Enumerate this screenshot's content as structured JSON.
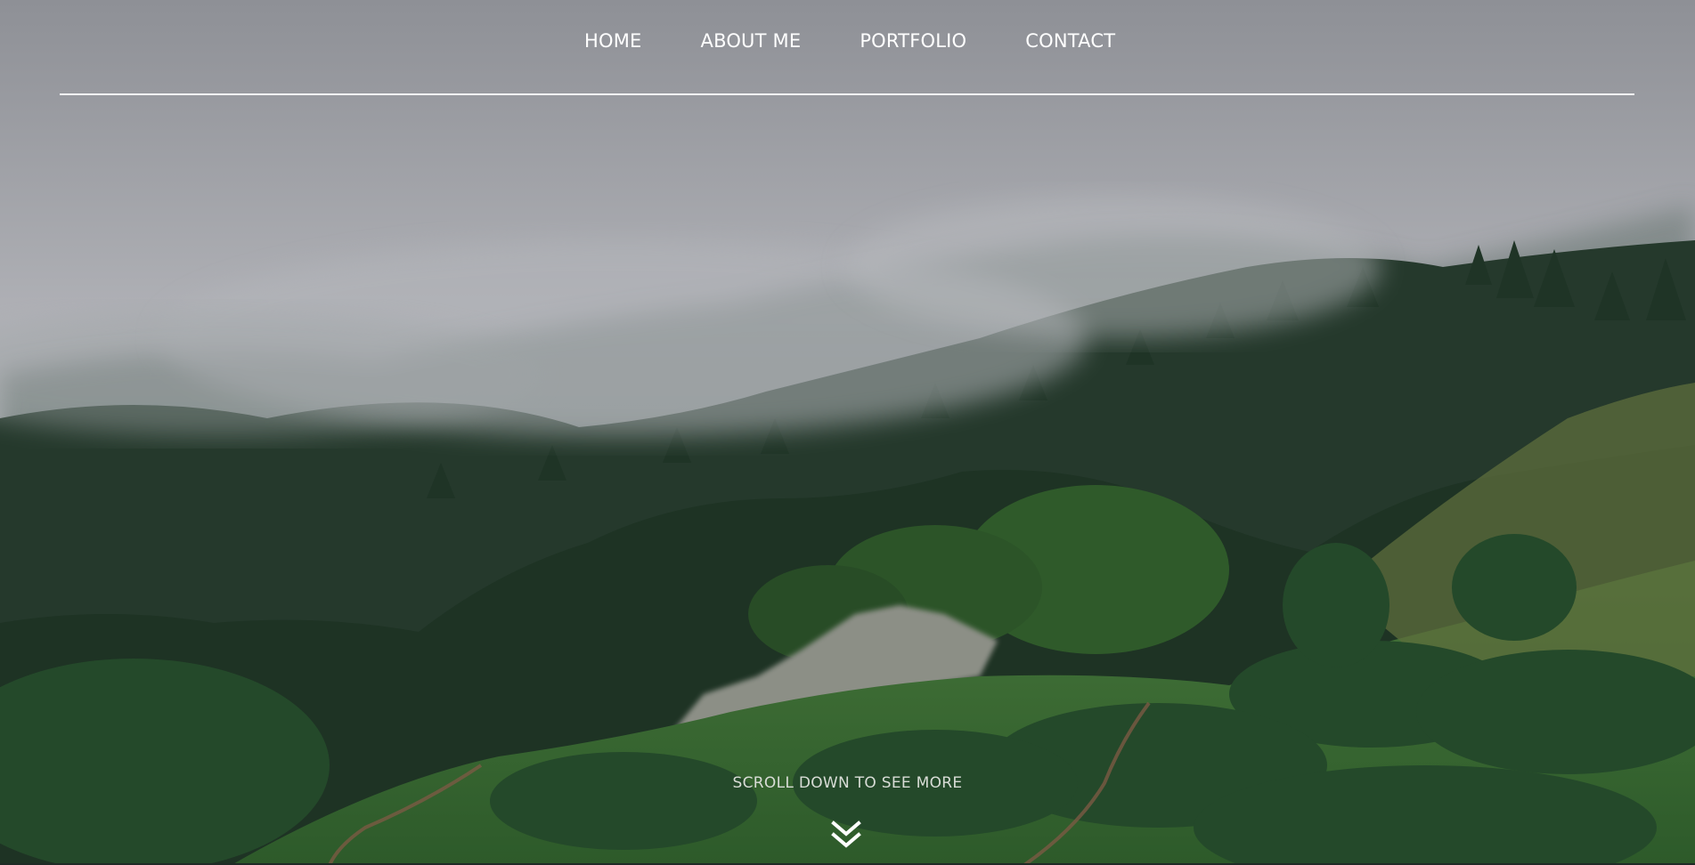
{
  "nav": {
    "items": [
      {
        "label": "HOME"
      },
      {
        "label": "ABOUT ME"
      },
      {
        "label": "PORTFOLIO"
      },
      {
        "label": "CONTACT"
      }
    ]
  },
  "hero": {
    "background": "foggy-forest-hillside-photo",
    "scroll_hint": "SCROLL DOWN TO SEE MORE",
    "scroll_icon": "double-chevron-down-icon"
  },
  "colors": {
    "nav_text": "#ffffff",
    "rule": "#ffffff",
    "fog": "#b9babf",
    "forest_dark": "#26402e",
    "grass": "#3c6a35"
  }
}
